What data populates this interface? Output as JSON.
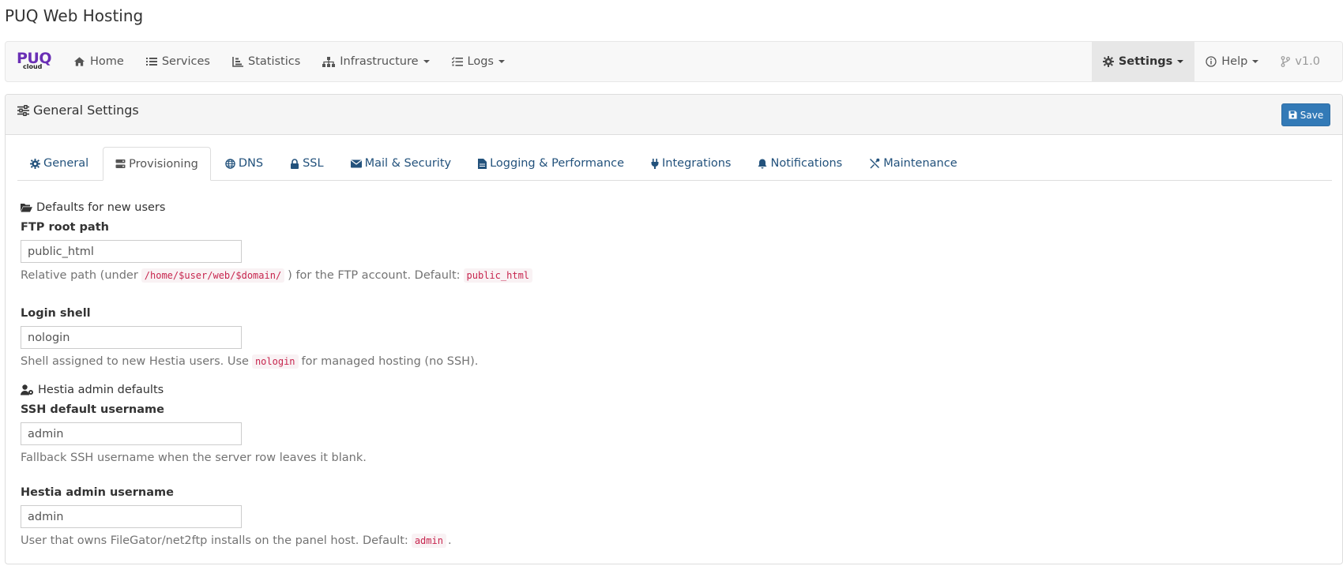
{
  "app": {
    "title": "PUQ Web Hosting"
  },
  "navbar": {
    "brand": {
      "logo_main": "PUQ",
      "logo_sub": "cloud"
    },
    "left_items": [
      {
        "label": "Home",
        "icon": "home-icon"
      },
      {
        "label": "Services",
        "icon": "list-icon"
      },
      {
        "label": "Statistics",
        "icon": "bar-chart-icon"
      },
      {
        "label": "Infrastructure",
        "icon": "sitemap-icon",
        "dropdown": true
      },
      {
        "label": "Logs",
        "icon": "list-check-icon",
        "dropdown": true
      }
    ],
    "right_items": [
      {
        "label": "Settings",
        "icon": "gear-icon",
        "dropdown": true,
        "active": true
      },
      {
        "label": "Help",
        "icon": "info-circle-icon",
        "dropdown": true
      },
      {
        "label": "v1.0",
        "icon": "code-branch-icon"
      }
    ]
  },
  "panel": {
    "title": "General Settings",
    "title_icon": "sliders-icon",
    "save_label": "Save",
    "save_icon": "floppy-disk-icon",
    "accent_color": "#337ab7"
  },
  "tabs": [
    {
      "label": "General",
      "icon": "gear-icon"
    },
    {
      "label": "Provisioning",
      "icon": "server-icon",
      "active": true
    },
    {
      "label": "DNS",
      "icon": "globe-icon"
    },
    {
      "label": "SSL",
      "icon": "lock-icon"
    },
    {
      "label": "Mail & Security",
      "icon": "envelope-icon"
    },
    {
      "label": "Logging & Performance",
      "icon": "file-lines-icon"
    },
    {
      "label": "Integrations",
      "icon": "plug-icon"
    },
    {
      "label": "Notifications",
      "icon": "bell-icon"
    },
    {
      "label": "Maintenance",
      "icon": "tools-icon"
    }
  ],
  "form": {
    "section_defaults": {
      "title": "Defaults for new users",
      "icon": "folder-open-icon"
    },
    "ftp_root": {
      "label": "FTP root path",
      "value": "public_html",
      "help_before": "Relative path (under",
      "help_code": "/home/$user/web/$domain/",
      "help_middle": ") for the FTP account. Default:",
      "help_code2": "public_html"
    },
    "login_shell": {
      "label": "Login shell",
      "value": "nologin",
      "help_before": "Shell assigned to new Hestia users. Use",
      "help_code": "nologin",
      "help_after": "for managed hosting (no SSH)."
    },
    "section_admin": {
      "title": "Hestia admin defaults",
      "icon": "user-gear-icon"
    },
    "ssh_username": {
      "label": "SSH default username",
      "value": "admin",
      "help": "Fallback SSH username when the server row leaves it blank."
    },
    "hestia_admin": {
      "label": "Hestia admin username",
      "value": "admin",
      "help_before": "User that owns FileGator/net2ftp installs on the panel host. Default:",
      "help_code": "admin",
      "help_after": "."
    }
  }
}
